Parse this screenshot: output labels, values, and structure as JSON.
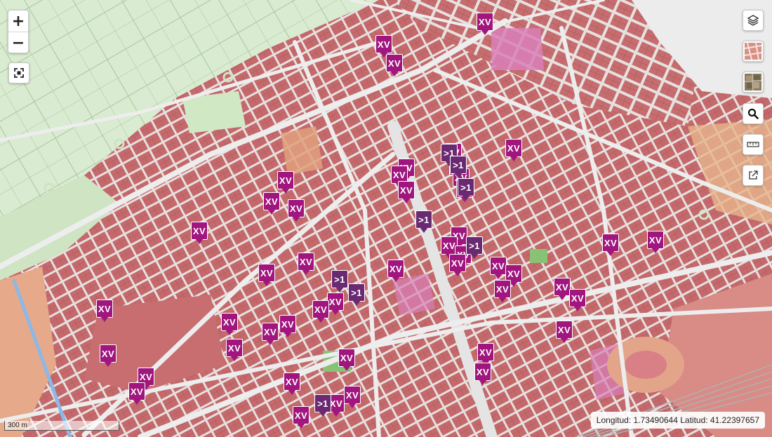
{
  "controls": {
    "zoom_in": "+",
    "zoom_out": "−",
    "fullscreen_icon": "fullscreen-icon",
    "right_buttons": [
      "layers-icon",
      "basemap-map-icon",
      "basemap-ortho-icon",
      "search-icon",
      "measure-icon",
      "external-link-icon"
    ]
  },
  "colors": {
    "xv_marker": "#a0167e",
    "cluster_marker": "#6a2a72",
    "urban": "#c96a6a",
    "agricultural": "#d4e6c8",
    "street": "#e8e4e2"
  },
  "markers": [
    {
      "label": "XV",
      "type": "xv"
    },
    {
      "label": "XV",
      "type": "xv"
    },
    {
      "label": "XV",
      "type": "xv"
    },
    {
      "label": "XV",
      "type": "xv"
    },
    {
      "label": "XV",
      "type": "xv"
    },
    {
      "label": "XV",
      "type": "xv"
    },
    {
      "label": "XV",
      "type": "xv"
    },
    {
      "label": "XV",
      "type": "xv"
    },
    {
      "label": "XV",
      "type": "xv"
    },
    {
      "label": "XV",
      "type": "xv"
    },
    {
      "label": ">1",
      "type": "cluster"
    },
    {
      "label": ">1",
      "type": "cluster"
    },
    {
      "label": ">1",
      "type": "cluster"
    },
    {
      "label": ">1",
      "type": "cluster"
    },
    {
      "label": "XV",
      "type": "xv"
    },
    {
      "label": "XV",
      "type": "xv"
    },
    {
      "label": "XV",
      "type": "xv"
    },
    {
      "label": "XV",
      "type": "xv"
    },
    {
      "label": "XV",
      "type": "xv"
    },
    {
      "label": "XV",
      "type": "xv"
    },
    {
      "label": "XV",
      "type": "xv"
    },
    {
      "label": "XV",
      "type": "xv"
    },
    {
      "label": ">1",
      "type": "cluster"
    },
    {
      "label": "XV",
      "type": "xv"
    },
    {
      "label": "XV",
      "type": "xv"
    },
    {
      "label": "XV",
      "type": "xv"
    },
    {
      "label": "XV",
      "type": "xv"
    },
    {
      "label": "XV",
      "type": "xv"
    },
    {
      "label": "XV",
      "type": "xv"
    },
    {
      "label": ">1",
      "type": "cluster"
    },
    {
      "label": ">1",
      "type": "cluster"
    },
    {
      "label": "XV",
      "type": "xv"
    },
    {
      "label": "XV",
      "type": "xv"
    },
    {
      "label": "XV",
      "type": "xv"
    },
    {
      "label": "XV",
      "type": "xv"
    },
    {
      "label": "XV",
      "type": "xv"
    },
    {
      "label": "XV",
      "type": "xv"
    },
    {
      "label": "XV",
      "type": "xv"
    },
    {
      "label": "XV",
      "type": "xv"
    },
    {
      "label": "XV",
      "type": "xv"
    },
    {
      "label": "XV",
      "type": "xv"
    },
    {
      "label": "XV",
      "type": "xv"
    },
    {
      "label": "XV",
      "type": "xv"
    },
    {
      "label": "XV",
      "type": "xv"
    },
    {
      "label": "XV",
      "type": "xv"
    },
    {
      "label": "XV",
      "type": "xv"
    },
    {
      "label": "XV",
      "type": "xv"
    },
    {
      "label": "XV",
      "type": "xv"
    },
    {
      "label": "XV",
      "type": "xv"
    },
    {
      "label": "XV",
      "type": "xv"
    },
    {
      "label": "XV",
      "type": "xv"
    },
    {
      "label": "XV",
      "type": "xv"
    },
    {
      "label": ">1",
      "type": "cluster"
    },
    {
      "label": "XV",
      "type": "xv"
    },
    {
      "label": "XV",
      "type": "xv"
    }
  ],
  "scale_label": "300 m",
  "coordinates_text": "Longitud: 1.73490644 Latitud: 41.22397657"
}
